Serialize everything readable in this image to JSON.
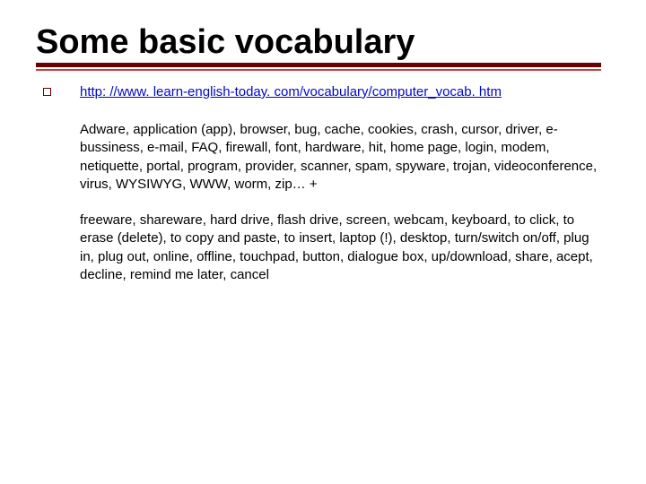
{
  "slide": {
    "title": "Some basic vocabulary",
    "link": "http: //www. learn-english-today. com/vocabulary/computer_vocab. htm",
    "para1": "Adware, application (app), browser, bug, cache, cookies, crash, cursor, driver, e-bussiness, e-mail, FAQ, firewall, font, hardware, hit, home page, login, modem, netiquette, portal, program, provider, scanner, spam, spyware, trojan, videoconference, virus, WYSIWYG, WWW, worm, zip… +",
    "para2": "freeware, shareware, hard drive, flash drive, screen, webcam, keyboard, to click, to erase (delete), to copy and paste, to insert, laptop (!), desktop, turn/switch on/off, plug in, plug out, online, offline, touchpad, button, dialogue box, up/download, share, acept, decline, remind me later, cancel"
  }
}
